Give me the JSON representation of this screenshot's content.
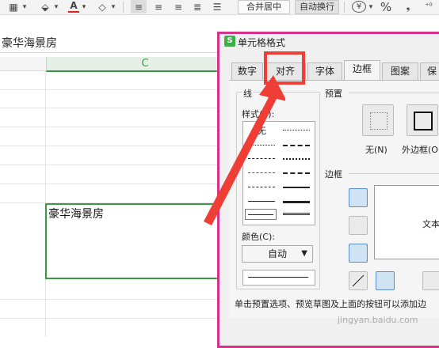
{
  "toolbar": {
    "merge_center_label": "合并居中",
    "wrap_text_label": "自动换行",
    "percent_symbol": "%",
    "currency_symbol": "¥",
    "font_color_letter": "A",
    "font_color_accent": "#e02020"
  },
  "formula_bar": {
    "content": "豪华海景房"
  },
  "sheet": {
    "column_header": "C",
    "cell_value": "豪华海景房",
    "accent_color": "#3a9a44"
  },
  "dialog": {
    "title": "单元格格式",
    "logo_text": "S",
    "tabs": [
      {
        "label": "数字"
      },
      {
        "label": "对齐"
      },
      {
        "label": "字体"
      },
      {
        "label": "边框"
      },
      {
        "label": "图案"
      },
      {
        "label": "保"
      }
    ],
    "active_tab": "边框",
    "line_group_label": "线",
    "style_label": "样式(S):",
    "style_none_label": "无",
    "color_label": "颜色(C):",
    "color_value": "自动",
    "preset_group_label": "预置",
    "preset_none_label": "无(N)",
    "preset_outline_label": "外边框(O",
    "border_group_label": "边框",
    "preview_text": "文本",
    "instruction": "单击预置选项、预览草图及上面的按钮可以添加边"
  },
  "annotation": {
    "highlight_color": "#ef3e36"
  },
  "watermark": "jingyan.baidu.com"
}
